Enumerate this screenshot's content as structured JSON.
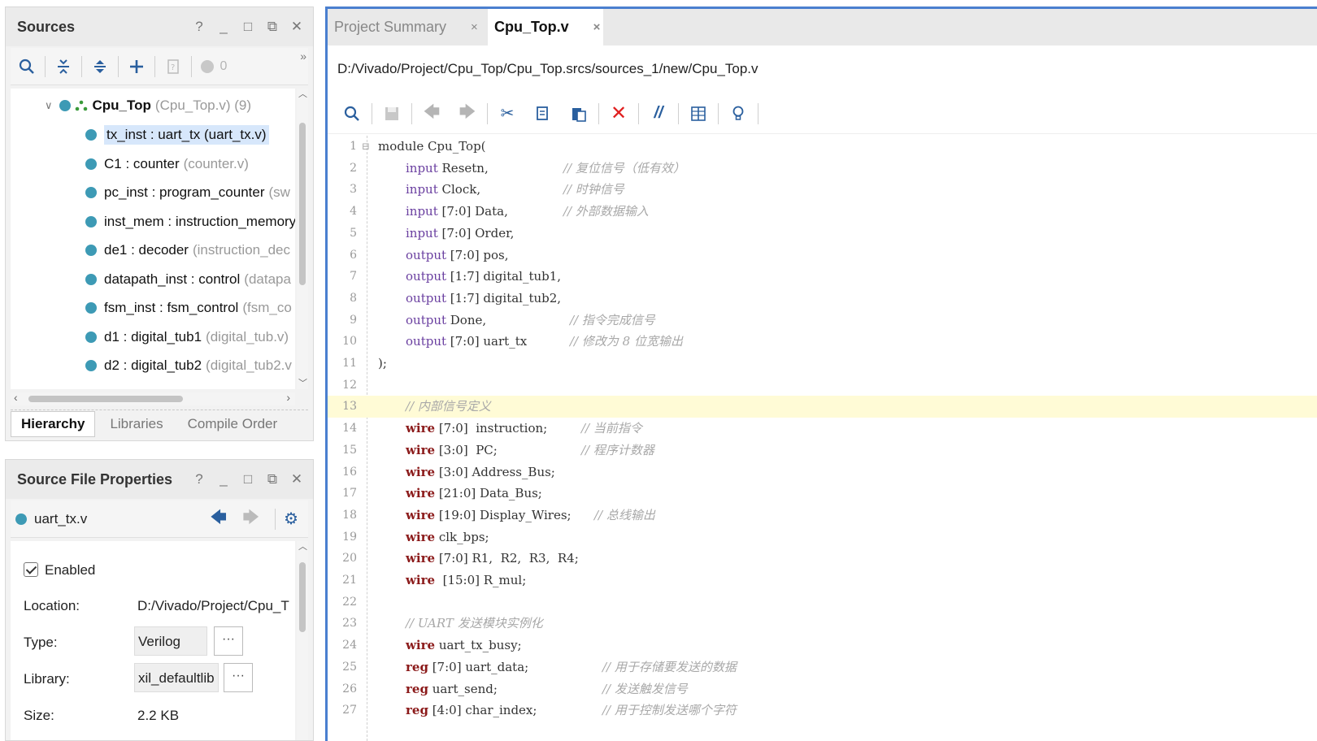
{
  "sources_panel": {
    "title": "Sources",
    "win_controls": [
      "?",
      "_",
      "□",
      "⧉",
      "✕"
    ],
    "toolbar": {
      "badge_count": "0",
      "more": "»"
    },
    "tree": {
      "root": {
        "name": "Cpu_Top",
        "detail": "(Cpu_Top.v) (9)"
      },
      "items": [
        {
          "name": "tx_inst : uart_tx (uart_tx.v)",
          "detail": "",
          "selected": true
        },
        {
          "name": "C1 : counter",
          "detail": "(counter.v)"
        },
        {
          "name": "pc_inst : program_counter",
          "detail": "(sw"
        },
        {
          "name": "inst_mem : instruction_memory",
          "detail": ""
        },
        {
          "name": "de1 : decoder",
          "detail": "(instruction_dec"
        },
        {
          "name": "datapath_inst : control",
          "detail": "(datapa"
        },
        {
          "name": "fsm_inst : fsm_control",
          "detail": "(fsm_co"
        },
        {
          "name": "d1 : digital_tub1",
          "detail": "(digital_tub.v)"
        },
        {
          "name": "d2 : digital_tub2",
          "detail": "(digital_tub2.v"
        }
      ]
    },
    "bottom_tabs": [
      "Hierarchy",
      "Libraries",
      "Compile Order"
    ]
  },
  "props_panel": {
    "title": "Source File Properties",
    "win_controls": [
      "?",
      "_",
      "□",
      "⧉",
      "✕"
    ],
    "file": "uart_tx.v",
    "enabled_label": "Enabled",
    "location_label": "Location:",
    "location_value": "D:/Vivado/Project/Cpu_T",
    "type_label": "Type:",
    "type_value": "Verilog",
    "library_label": "Library:",
    "library_value": "xil_defaultlib",
    "size_label": "Size:",
    "size_value": "2.2 KB",
    "ellipsis": "···"
  },
  "editor": {
    "tabs": [
      {
        "label": "Project Summary",
        "active": false
      },
      {
        "label": "Cpu_Top.v",
        "active": true
      }
    ],
    "tab_close": "×",
    "filepath": "D:/Vivado/Project/Cpu_Top/Cpu_Top.srcs/sources_1/new/Cpu_Top.v",
    "code_lines": [
      {
        "n": "1",
        "kw": "",
        "rest": "module Cpu_Top(",
        "cm": ""
      },
      {
        "n": "2",
        "kw": "input",
        "rest": " Resetn,",
        "cm": "// 复位信号（低有效）",
        "kwc": "in",
        "cmx": 228
      },
      {
        "n": "3",
        "kw": "input",
        "rest": " Clock,",
        "cm": "// 时钟信号",
        "kwc": "in",
        "cmx": 228
      },
      {
        "n": "4",
        "kw": "input",
        "rest": " [7:0] Data,",
        "cm": "// 外部数据输入",
        "kwc": "in",
        "cmx": 228
      },
      {
        "n": "5",
        "kw": "input",
        "rest": " [7:0] Order,",
        "cm": "",
        "kwc": "in"
      },
      {
        "n": "6",
        "kw": "output",
        "rest": " [7:0] pos,",
        "cm": "",
        "kwc": "in"
      },
      {
        "n": "7",
        "kw": "output",
        "rest": " [1:7] digital_tub1,",
        "cm": "",
        "kwc": "in"
      },
      {
        "n": "8",
        "kw": "output",
        "rest": " [1:7] digital_tub2,",
        "cm": "",
        "kwc": "in"
      },
      {
        "n": "9",
        "kw": "output",
        "rest": " Done,",
        "cm": "// 指令完成信号",
        "kwc": "in",
        "cmx": 236
      },
      {
        "n": "10",
        "kw": "output",
        "rest": " [7:0] uart_tx",
        "cm": "// 修改为 8 位宽输出",
        "kwc": "in",
        "cmx": 236
      },
      {
        "n": "11",
        "kw": "",
        "rest": ");",
        "cm": ""
      },
      {
        "n": "12",
        "kw": "",
        "rest": "",
        "cm": ""
      },
      {
        "n": "13",
        "kw": "",
        "rest": "",
        "cm": "// 内部信号定义",
        "cmx": 34,
        "hl": true
      },
      {
        "n": "14",
        "kw": "wire",
        "rest": " [7:0]  instruction;",
        "cm": "// 当前指令",
        "kwc": "wire",
        "cmx": 250
      },
      {
        "n": "15",
        "kw": "wire",
        "rest": " [3:0]  PC;",
        "cm": "// 程序计数器",
        "kwc": "wire",
        "cmx": 250
      },
      {
        "n": "16",
        "kw": "wire",
        "rest": " [3:0] Address_Bus;",
        "cm": "",
        "kwc": "wire"
      },
      {
        "n": "17",
        "kw": "wire",
        "rest": " [21:0] Data_Bus;",
        "cm": "",
        "kwc": "wire"
      },
      {
        "n": "18",
        "kw": "wire",
        "rest": " [19:0] Display_Wires;",
        "cm": "// 总线输出",
        "kwc": "wire",
        "cmx": 266
      },
      {
        "n": "19",
        "kw": "wire",
        "rest": " clk_bps;",
        "cm": "",
        "kwc": "wire"
      },
      {
        "n": "20",
        "kw": "wire",
        "rest": " [7:0] R1,  R2,  R3,  R4;",
        "cm": "",
        "kwc": "wire"
      },
      {
        "n": "21",
        "kw": "wire",
        "rest": "  [15:0] R_mul;",
        "cm": "",
        "kwc": "wire"
      },
      {
        "n": "22",
        "kw": "",
        "rest": "",
        "cm": ""
      },
      {
        "n": "23",
        "kw": "",
        "rest": "",
        "cm": "// UART 发送模块实例化",
        "cmx": 34
      },
      {
        "n": "24",
        "kw": "wire",
        "rest": " uart_tx_busy;",
        "cm": "",
        "kwc": "wire"
      },
      {
        "n": "25",
        "kw": "reg",
        "rest": " [7:0] uart_data;",
        "cm": "// 用于存储要发送的数据",
        "kwc": "wire",
        "cmx": 276
      },
      {
        "n": "26",
        "kw": "reg",
        "rest": " uart_send;",
        "cm": "// 发送触发信号",
        "kwc": "wire",
        "cmx": 276
      },
      {
        "n": "27",
        "kw": "reg",
        "rest": " [4:0] char_index;",
        "cm": "// 用于控制发送哪个字符",
        "kwc": "wire",
        "cmx": 276
      }
    ]
  }
}
